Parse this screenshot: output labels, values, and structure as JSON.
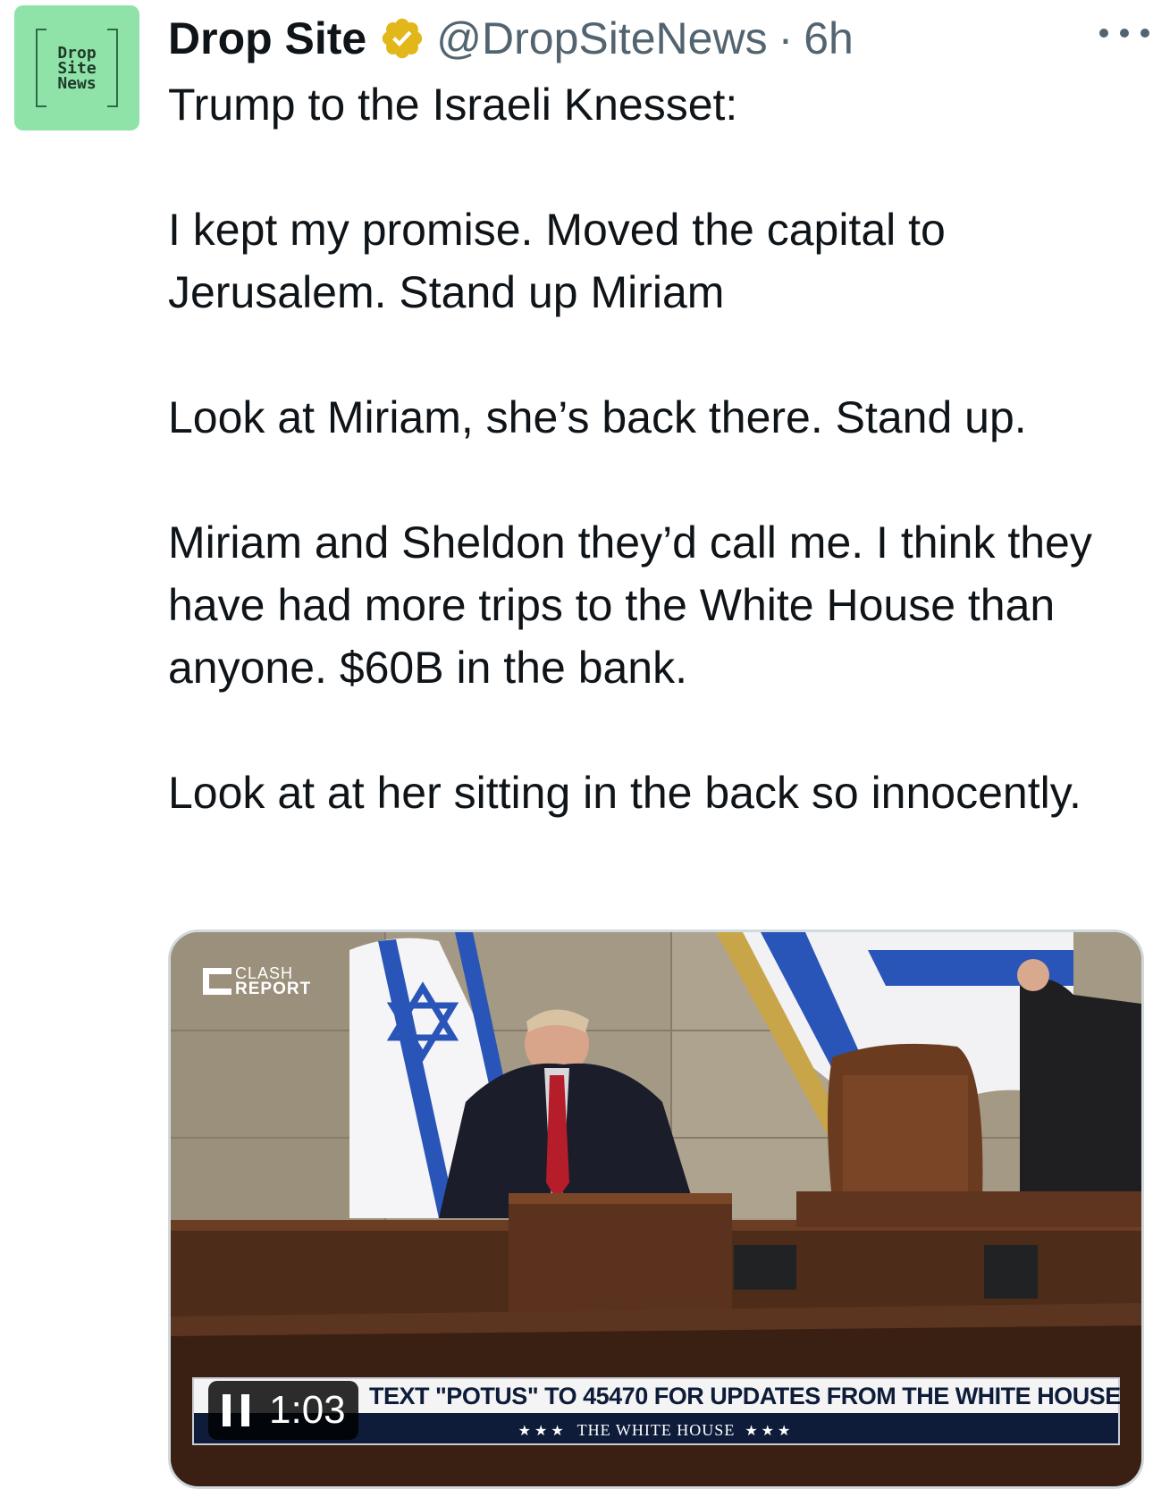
{
  "author": {
    "display_name": "Drop Site",
    "handle": "@DropSiteNews",
    "separator": "·",
    "time": "6h",
    "avatar_lines": [
      "Drop",
      "Site",
      "News"
    ],
    "avatar_bg": "#8fe3a9",
    "verified_icon": "gold-verified-badge-icon",
    "verified_color": "#e2b719"
  },
  "tweet": {
    "paragraphs": [
      "Trump to the Israeli Knesset:",
      "I kept my promise. Moved the capital to Jerusalem. Stand up Miriam",
      "Look at Miriam, she’s back there. Stand up.",
      "Miriam and Sheldon they’d call me. I think they have had more trips to the White House than anyone. $60B in the bank.",
      "Look at at her sitting in the back so innocently."
    ]
  },
  "menu": {
    "icon": "more-horizontal-icon"
  },
  "video": {
    "watermark_top": "CLASH",
    "watermark_bottom": "REPORT",
    "banner_text": "TEXT \"POTUS\" TO 45470 FOR UPDATES FROM THE WHITE HOUSE",
    "banner_sub": "THE WHITE HOUSE",
    "banner_stars": "★★★",
    "duration": "1:03",
    "control_icon": "pause-icon"
  }
}
